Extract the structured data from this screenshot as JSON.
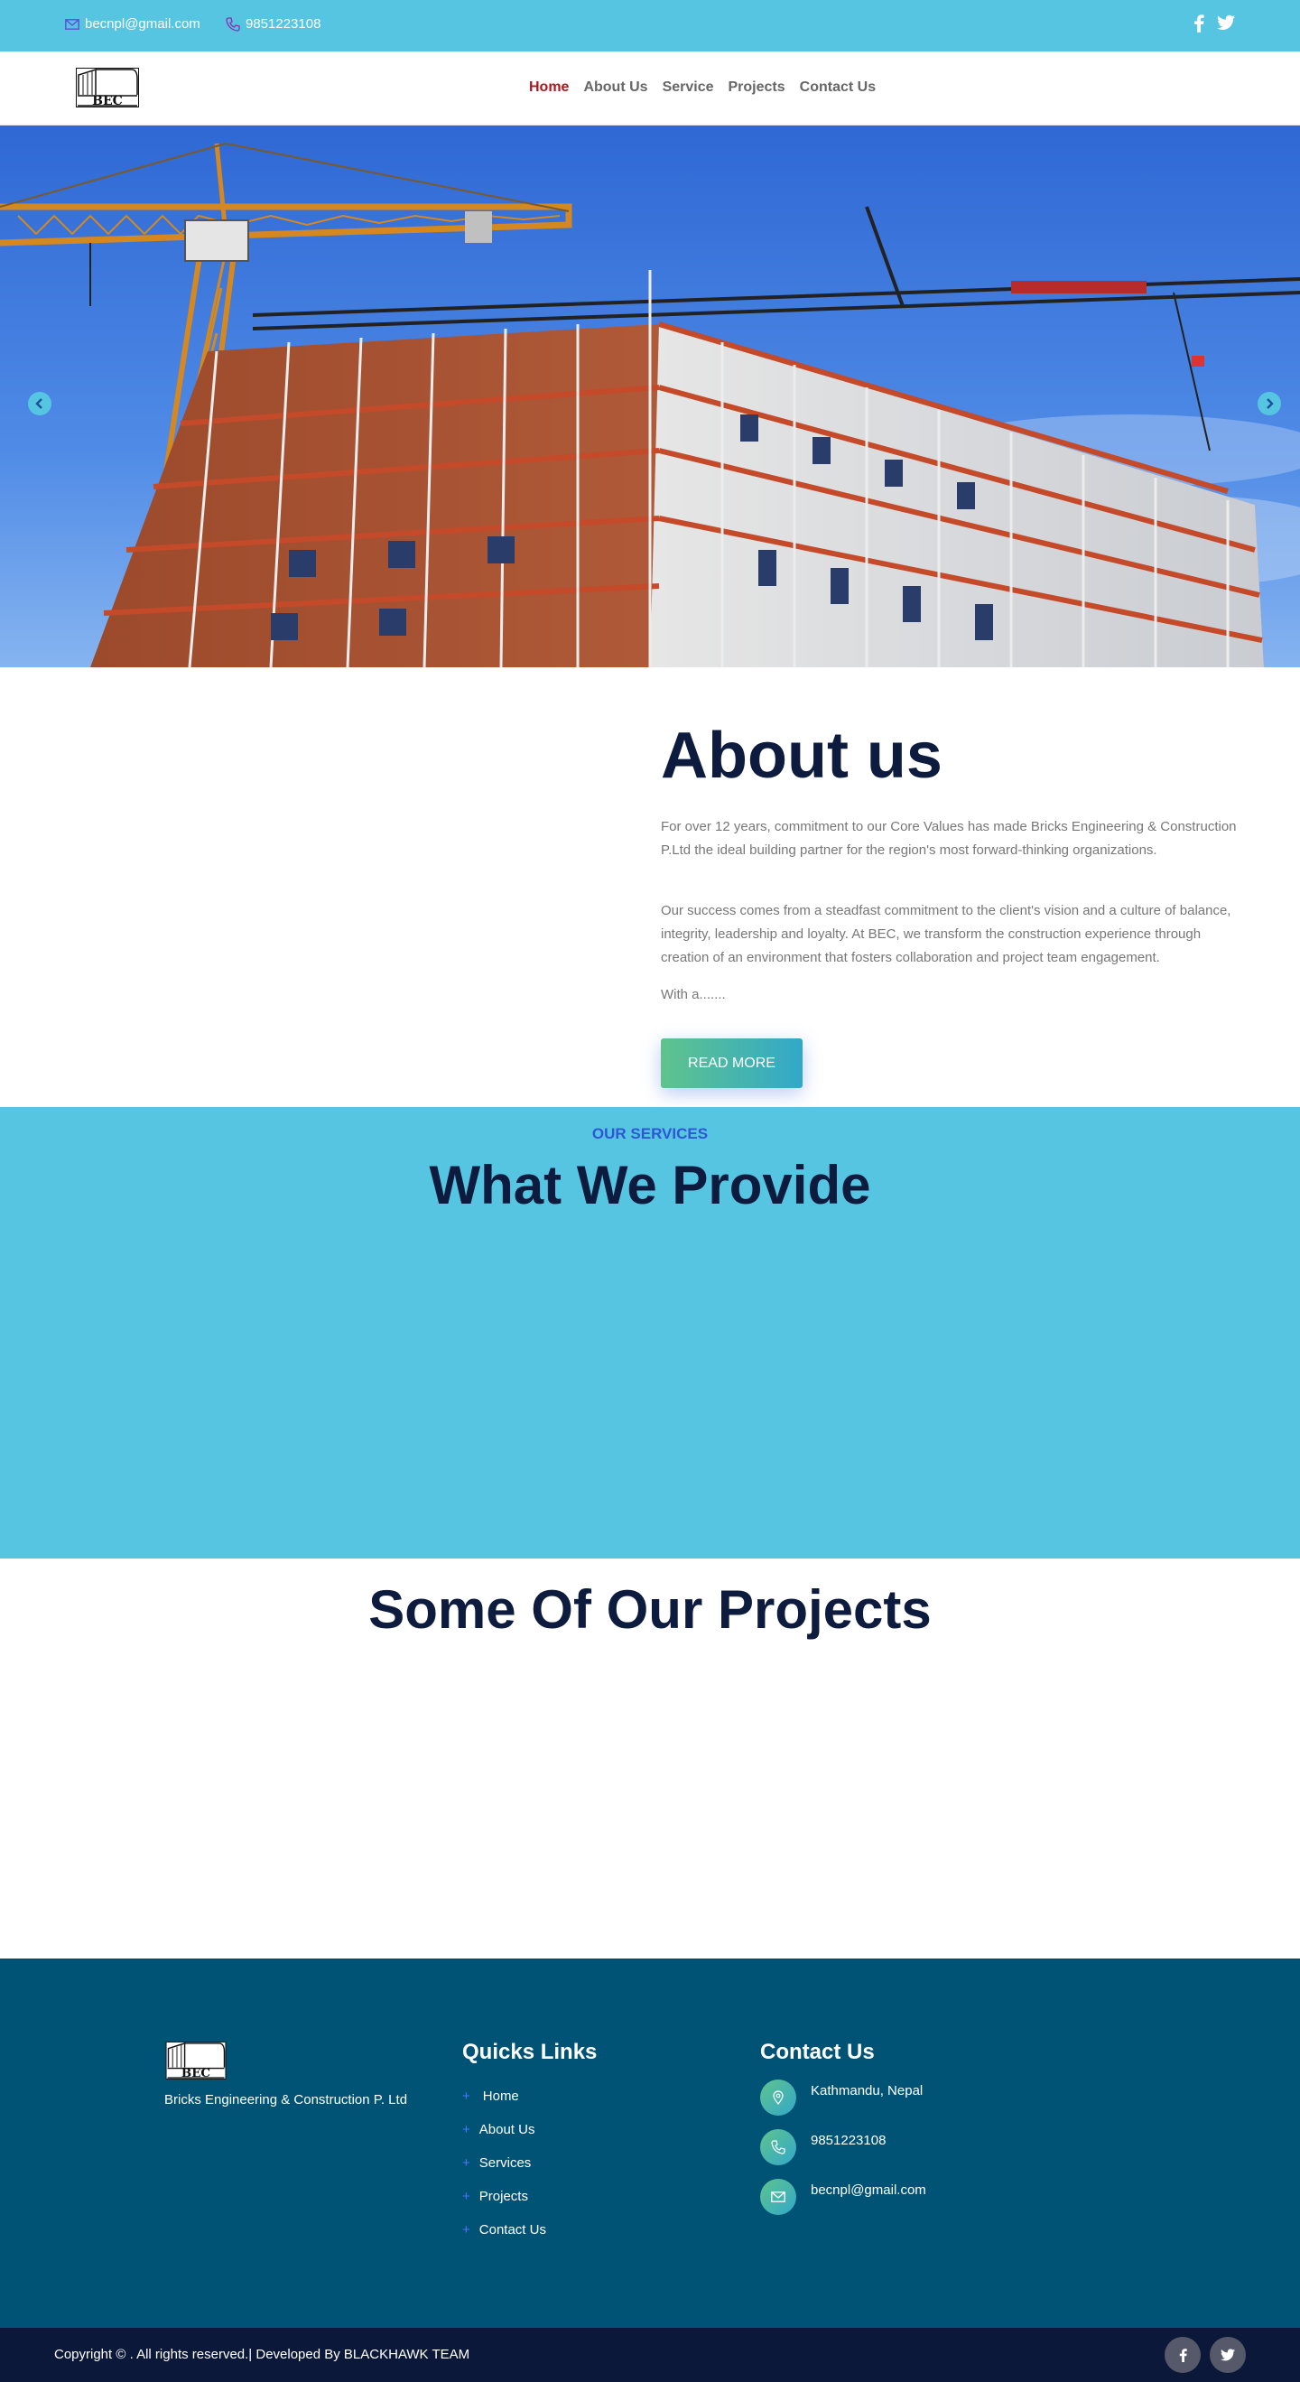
{
  "topbar": {
    "email": "becnpl@gmail.com",
    "phone": "9851223108",
    "icons": [
      "mail-icon",
      "phone-icon",
      "facebook-icon",
      "twitter-icon"
    ]
  },
  "header": {
    "logo_text": "BEC",
    "nav": [
      {
        "label": "Home",
        "active": true
      },
      {
        "label": "About Us",
        "active": false
      },
      {
        "label": "Service",
        "active": false
      },
      {
        "label": "Projects",
        "active": false
      },
      {
        "label": "Contact Us",
        "active": false
      }
    ]
  },
  "hero": {
    "icons": [
      "arrow-left-icon",
      "arrow-right-icon"
    ]
  },
  "about": {
    "title": "About us",
    "p1": "For over 12 years, commitment to our Core Values has made Bricks Engineering & Construction P.Ltd the ideal building partner for the region's most forward-thinking organizations.",
    "p2": "Our success comes from a steadfast commitment to the client's vision and a culture of balance, integrity, leadership and loyalty. At BEC, we transform the construction experience through creation of an environment that fosters collaboration and project team engagement.",
    "p3": "With a.......",
    "button": "READ MORE"
  },
  "services": {
    "kicker": "OUR SERVICES",
    "title": "What We Provide"
  },
  "projects": {
    "title": "Some Of Our Projects"
  },
  "footer": {
    "tagline": "Bricks Engineering & Construction P. Ltd",
    "links_title": "Quicks Links",
    "links": [
      "Home",
      "About Us",
      "Services",
      "Projects",
      "Contact Us"
    ],
    "contact_title": "Contact Us",
    "address": "Kathmandu, Nepal",
    "phone": "9851223108",
    "email": "becnpl@gmail.com"
  },
  "bottom": {
    "copyright": "Copyright © . All rights reserved.| Developed By BLACKHAWK TEAM"
  },
  "colors": {
    "accent_cyan": "#56c5e2",
    "navy": "#0d1b3e",
    "footer_blue": "#005375",
    "active_red": "#b0161d"
  }
}
